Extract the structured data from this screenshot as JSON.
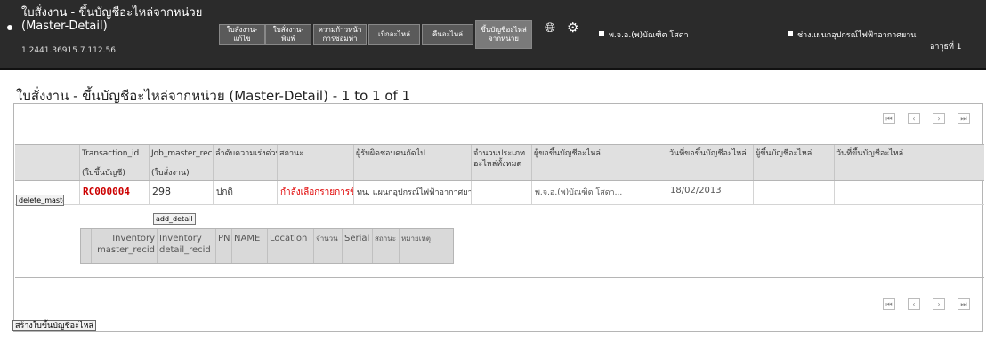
{
  "header": {
    "title_line1": "ใบสั่งงาน - ขึ้นบัญชีอะไหล่จากหน่วย",
    "title_line2": "(Master-Detail)",
    "version": "1.2441.36915.7.112.56",
    "nav": [
      "ใบสั่งงาน-แก้ไข",
      "ใบสั่งงาน-พิมพ์",
      "ความก้าวหน้า การซ่อมทำ",
      "เบิกอะไหล่",
      "คืนอะไหล่",
      "ขึ้นบัญชีอะไหล่ จากหน่วย"
    ],
    "user_name": "พ.จ.อ.(พ)บัณฑิต โสดา",
    "department": "ช่างแผนกอุปกรณ์ไฟฟ้าอากาศยาน",
    "department_tail": "อาวุธที่ 1"
  },
  "page": {
    "title": "ใบสั่งงาน - ขึ้นบัญชีอะไหล่จากหน่วย (Master-Detail) - 1 to 1 of 1"
  },
  "master": {
    "headers": [
      {
        "label": "Transaction_id",
        "sub": "(ใบขึ้นบัญชี)"
      },
      {
        "label": "Job_master_recid",
        "sub": "(ใบสั่งงาน)"
      },
      {
        "label": "ลำดับความเร่งด่วน",
        "sub": ""
      },
      {
        "label": "สถานะ",
        "sub": ""
      },
      {
        "label": "ผู้รับผิดชอบคนถัดไป",
        "sub": ""
      },
      {
        "label": "จำนวนประเภท อะไหล่ทั้งหมด",
        "sub": ""
      },
      {
        "label": "ผู้ขอขึ้นบัญชีอะไหล่",
        "sub": ""
      },
      {
        "label": "วันที่ขอขึ้นบัญชีอะไหล่",
        "sub": ""
      },
      {
        "label": "ผู้ขึ้นบัญชีอะไหล่",
        "sub": ""
      },
      {
        "label": "วันที่ขึ้นบัญชีอะไหล่",
        "sub": ""
      }
    ],
    "row": {
      "delete_label": "delete_master",
      "transaction_id": "RC000004",
      "job_master_recid": "298",
      "priority": "ปกติ",
      "status": "กำลังเลือกรายการขึ้นบัญชี",
      "next_responsible": "ทน. แผนกอุปกรณ์ไฟฟ้าอากาศยาน",
      "part_types": "",
      "requester": "พ.จ.อ.(พ)บัณฑิต โสดา...",
      "request_date": "18/02/2013",
      "recorder": "",
      "record_date": ""
    },
    "add_detail_label": "add_detail"
  },
  "detail": {
    "headers": [
      "Inventory master_recid",
      "Inventory detail_recid",
      "PN",
      "NAME",
      "Location",
      "จำนวน",
      "Serial",
      "สถานะ",
      "หมายเหตุ"
    ]
  },
  "footer": {
    "create_label": "สร้างใบขึ้นบัญชีอะไหล่"
  },
  "colors": {
    "header_bg": "#2b2b2b",
    "status_red": "#e00000",
    "id_red": "#cc0000"
  }
}
